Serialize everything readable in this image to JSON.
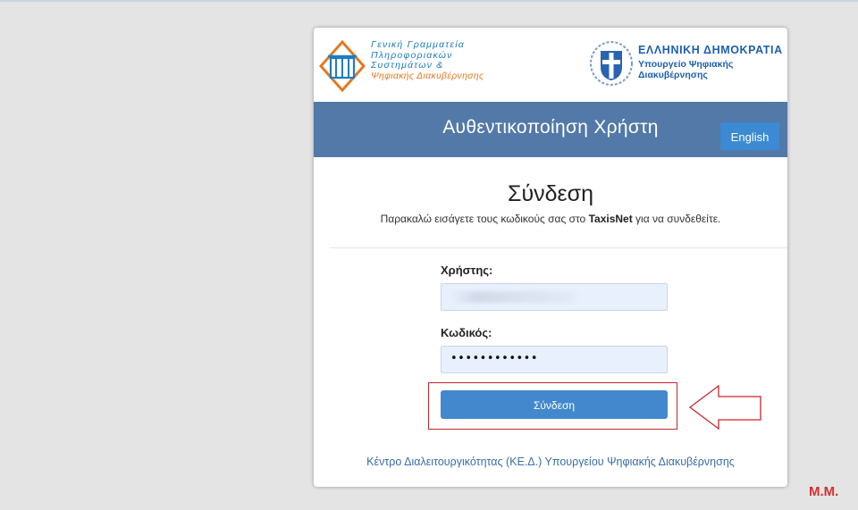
{
  "header": {
    "org_lines": [
      "Γενική Γραμματεία",
      "Πληροφοριακών",
      "Συστημάτων &",
      "Ψηφιακής Διακυβέρνησης"
    ],
    "republic_title": "ΕΛΛΗΝΙΚΗ ΔΗΜΟΚΡΑΤΙΑ",
    "ministry_lines": [
      "Υπουργείο Ψηφιακής",
      "Διακυβέρνησης"
    ]
  },
  "band": {
    "title": "Αυθεντικοποίηση Χρήστη",
    "language_button": "English"
  },
  "login": {
    "title": "Σύνδεση",
    "subtitle_before": "Παρακαλώ εισάγετε τους κωδικούς σας στο ",
    "subtitle_brand": "TaxisNet",
    "subtitle_after": " για να συνδεθείτε.",
    "username_label": "Χρήστης:",
    "username_value": "",
    "password_label": "Κωδικός:",
    "password_value": "••••••••••••",
    "submit_label": "Σύνδεση"
  },
  "footer": {
    "link_text": "Κέντρο Διαλειτουργικότητας (ΚΕ.Δ.) Υπουργείου Ψηφιακής Διακυβέρνησης"
  },
  "annotations": {
    "signature": "M.M.",
    "highlight_color": "#c6262c"
  },
  "colors": {
    "band": "#5279a8",
    "button": "#4388cd",
    "link": "#3a6ea5"
  }
}
